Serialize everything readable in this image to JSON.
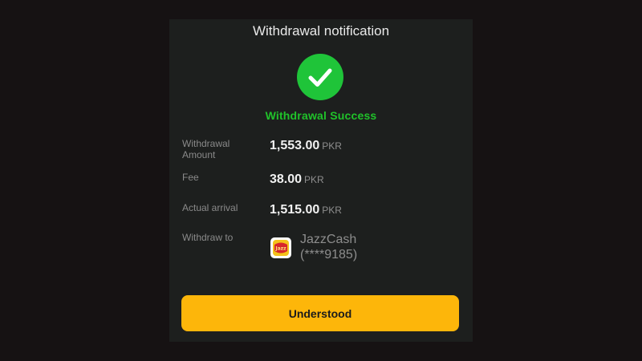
{
  "modal": {
    "title": "Withdrawal notification",
    "status_icon": "check-circle-icon",
    "status_color": "#1fc439",
    "status_text": "Withdrawal Success",
    "status_text_color": "#20c22a"
  },
  "details": {
    "amount": {
      "label": "Withdrawal Amount",
      "value": "1,553.00",
      "unit": "PKR"
    },
    "fee": {
      "label": "Fee",
      "value": "38.00",
      "unit": "PKR"
    },
    "actual": {
      "label": "Actual arrival",
      "value": "1,515.00",
      "unit": "PKR"
    },
    "withdraw_to": {
      "label": "Withdraw to",
      "wallet_icon": "jazzcash-logo-icon",
      "wallet_name": "JazzCash",
      "account": "(****9185)"
    }
  },
  "actions": {
    "understood_label": "Understood",
    "button_color": "#fdb60a"
  }
}
